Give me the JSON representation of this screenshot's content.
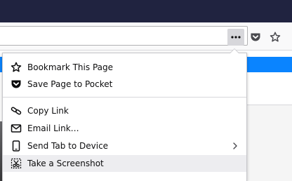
{
  "toolbar": {
    "page_actions_icon": "more-horizontal-icon",
    "pocket_icon": "pocket-icon",
    "bookmark_icon": "star-outline-icon"
  },
  "menu": {
    "items": [
      {
        "label": "Bookmark This Page",
        "icon": "star-outline-icon"
      },
      {
        "label": "Save Page to Pocket",
        "icon": "pocket-icon"
      },
      {
        "label": "Copy Link",
        "icon": "link-icon"
      },
      {
        "label": "Email Link…",
        "icon": "mail-icon"
      },
      {
        "label": "Send Tab to Device",
        "icon": "device-icon",
        "submenu": true
      },
      {
        "label": "Take a Screenshot",
        "icon": "screenshot-icon",
        "highlighted": true
      }
    ]
  },
  "colors": {
    "title_bar": "#202340",
    "accent_band": "#0a84ff",
    "menu_hover": "#ededf0"
  }
}
